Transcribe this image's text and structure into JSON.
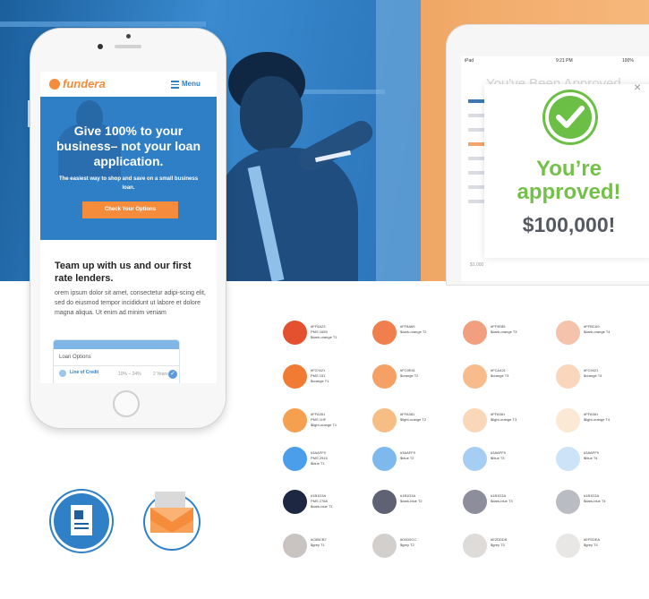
{
  "phone": {
    "logo": "fundera",
    "menu_label": "Menu",
    "headline": "Give 100% to your business– not your loan application.",
    "subtext": "The easiest way to shop and save on a small business loan.",
    "cta_label": "Check Your Options",
    "section_title": "Team up with us and our first rate lenders.",
    "section_body": "orem ipsum dolor sit amet, consectetur adipi-scing elit, sed do eiusmod tempor incididunt ut labore et dolore magna aliqua. Ut enim ad minim veniam",
    "loan_card": {
      "title": "Loan Options",
      "item_label": "Line of Credit",
      "item_rate": "10% – 24%",
      "item_term": "2 Years"
    }
  },
  "tablet": {
    "status_left": "iPad",
    "status_time": "9:21 PM",
    "status_right": "100%",
    "background_title": "You've Been Approved",
    "modal_title": "You’re approved!",
    "modal_amount": "$100,000!",
    "close_glyph": "×",
    "under_text": "$1,000"
  },
  "icons": {
    "document": "document-icon",
    "mail": "envelope-icon"
  },
  "palette": {
    "rows": [
      [
        {
          "hex": "#E4512F",
          "lines": [
            "#FF5A23",
            "PMS 1655",
            "$dark-orange T1"
          ]
        },
        {
          "hex": "#F07F4D",
          "lines": [
            "#FF8A69",
            "$dark-orange T2"
          ]
        },
        {
          "hex": "#F29F7F",
          "lines": [
            "#FF9E85",
            "$dark-orange T3"
          ]
        },
        {
          "hex": "#F5C2AC",
          "lines": [
            "#FFBCA9",
            "$dark-orange T4"
          ]
        }
      ],
      [
        {
          "hex": "#F27B33",
          "lines": [
            "#F07A21",
            "PMS 151",
            "$orange T1"
          ]
        },
        {
          "hex": "#F5A064",
          "lines": [
            "#FC9E61",
            "$orange T2"
          ]
        },
        {
          "hex": "#F8BC8C",
          "lines": [
            "#FCA421",
            "$orange T3"
          ]
        },
        {
          "hex": "#FAD6BC",
          "lines": [
            "#FC9421",
            "$orange T4"
          ]
        }
      ],
      [
        {
          "hex": "#F4A04E",
          "lines": [
            "#FFA351",
            "PMS 1HF",
            "$light-orange T1"
          ]
        },
        {
          "hex": "#F6BE85",
          "lines": [
            "#FFA381",
            "$light-orange T2"
          ]
        },
        {
          "hex": "#FAD7B8",
          "lines": [
            "#FFA381",
            "$light-orange T3"
          ]
        },
        {
          "hex": "#FBE8D5",
          "lines": [
            "#FFA381",
            "$light-orange T4"
          ]
        }
      ],
      [
        {
          "hex": "#4B9EEA",
          "lines": [
            "#3AAFF9",
            "PMS 2915",
            "$blue T1"
          ]
        },
        {
          "hex": "#7EB9EE",
          "lines": [
            "#3AAFF9",
            "$blue T2"
          ]
        },
        {
          "hex": "#A6CEF3",
          "lines": [
            "#3AAFF9",
            "$blue T3"
          ]
        },
        {
          "hex": "#CCE3F8",
          "lines": [
            "#3AAFF9",
            "$blue T4"
          ]
        }
      ],
      [
        {
          "hex": "#1E2742",
          "lines": [
            "#1B1D3A",
            "PMS 2768",
            "$dark-blue T1"
          ]
        },
        {
          "hex": "#5E6272",
          "lines": [
            "#1B1D3A",
            "$dark-blue T2"
          ]
        },
        {
          "hex": "#8C8F9B",
          "lines": [
            "#1B1D3A",
            "$dark-blue T3"
          ]
        },
        {
          "hex": "#BABCC4",
          "lines": [
            "#1B1D3A",
            "$dark-blue T4"
          ]
        }
      ],
      [
        {
          "hex": "#C9C3C1",
          "lines": [
            "#C8BCB7",
            "$grey T1"
          ]
        },
        {
          "hex": "#D3CFCC",
          "lines": [
            "#D0D5CC",
            "$grey T2"
          ]
        },
        {
          "hex": "#DEDBD8",
          "lines": [
            "#E2DDD8",
            "$grey T3"
          ]
        },
        {
          "hex": "#E9E7E5",
          "lines": [
            "#EFEDEA",
            "$grey T4"
          ]
        }
      ]
    ]
  }
}
